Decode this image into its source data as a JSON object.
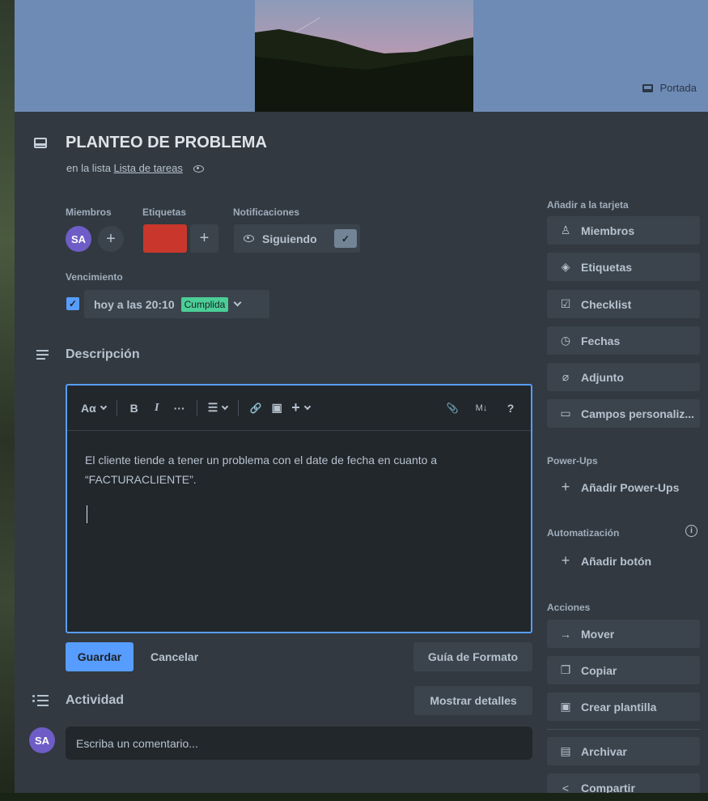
{
  "cover": {
    "button_label": "Portada",
    "icon": "cover-icon"
  },
  "card": {
    "title": "PLANTEO DE PROBLEMA",
    "list_prefix": "en la lista",
    "list_name": "Lista de tareas"
  },
  "members": {
    "label": "Miembros",
    "avatar_initials": "SA"
  },
  "labels": {
    "label": "Etiquetas",
    "label_color": "#c9372c"
  },
  "notifications": {
    "label": "Notificaciones",
    "button_label": "Siguiendo"
  },
  "due": {
    "label": "Vencimiento",
    "value": "hoy a las 20:10",
    "badge": "Cumplida",
    "checked": true
  },
  "description": {
    "title": "Descripción",
    "toolbar": {
      "text_style": "Aα",
      "bold": "B",
      "italic": "I",
      "more": "···",
      "list": "☰",
      "link": "🔗",
      "image": "▣",
      "insert": "+",
      "attach": "📎",
      "markdown": "M↓",
      "help": "?"
    },
    "text": "El cliente tiende a tener un problema con el date de fecha en cuanto a “FACTURACLIENTE”."
  },
  "actions_bar": {
    "save": "Guardar",
    "cancel": "Cancelar",
    "format_guide": "Guía de Formato"
  },
  "activity": {
    "title": "Actividad",
    "show_details": "Mostrar detalles",
    "comment_placeholder": "Escriba un comentario...",
    "avatar_initials": "SA"
  },
  "sidebar": {
    "add_to_card_label": "Añadir a la tarjeta",
    "add_to_card": [
      {
        "label": "Miembros",
        "icon": "person-icon"
      },
      {
        "label": "Etiquetas",
        "icon": "tag-icon"
      },
      {
        "label": "Checklist",
        "icon": "checklist-icon"
      },
      {
        "label": "Fechas",
        "icon": "clock-icon"
      },
      {
        "label": "Adjunto",
        "icon": "paperclip-icon"
      },
      {
        "label": "Campos personaliz...",
        "icon": "custom-fields-icon"
      }
    ],
    "powerups_label": "Power-Ups",
    "add_powerups": "Añadir Power-Ups",
    "automation_label": "Automatización",
    "add_button": "Añadir botón",
    "actions_label": "Acciones",
    "actions": [
      {
        "label": "Mover",
        "icon": "arrow-right-icon"
      },
      {
        "label": "Copiar",
        "icon": "copy-icon"
      },
      {
        "label": "Crear plantilla",
        "icon": "template-icon"
      },
      {
        "label": "Archivar",
        "icon": "archive-icon"
      },
      {
        "label": "Compartir",
        "icon": "share-icon"
      }
    ]
  },
  "colors": {
    "accent": "#579dff",
    "panel": "#323940",
    "button": "#3b444c",
    "success": "#4bce97",
    "avatar": "#6e5dc6"
  }
}
